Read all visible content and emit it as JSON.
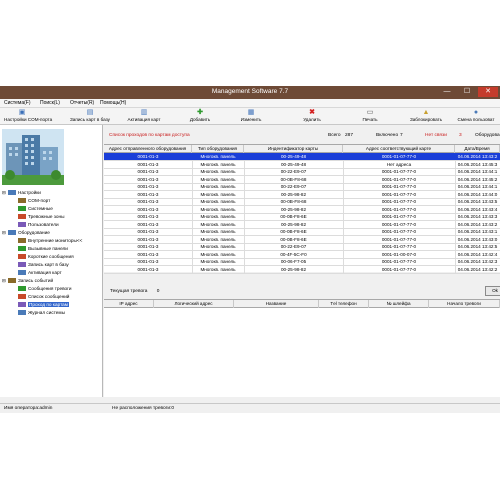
{
  "window": {
    "title": "Management Software 7.7"
  },
  "menu": [
    "Система(F)",
    "Поиск(L)",
    "Отчеты(R)",
    "Помощь(H)"
  ],
  "toolbar": [
    {
      "label": "Настройки COM-порта",
      "icon": "com-port-icon"
    },
    {
      "label": "Запись карт в базу",
      "icon": "card-write-icon"
    },
    {
      "label": "Активация карт",
      "icon": "card-activate-icon"
    },
    {
      "label": "Добавить",
      "icon": "add-icon"
    },
    {
      "label": "Изменить",
      "icon": "edit-icon"
    },
    {
      "label": "Удалить",
      "icon": "delete-icon"
    },
    {
      "label": "Печать",
      "icon": "print-icon"
    },
    {
      "label": "Заблокировать",
      "icon": "lock-icon"
    },
    {
      "label": "Смена пользоват",
      "icon": "user-switch-icon"
    }
  ],
  "tree": [
    {
      "label": "Настройки",
      "level": 0,
      "expander": "⊟"
    },
    {
      "label": "COM-порт",
      "level": 1
    },
    {
      "label": "Системные",
      "level": 1
    },
    {
      "label": "Тревожные зоны",
      "level": 1
    },
    {
      "label": "Пользователи",
      "level": 1
    },
    {
      "label": "Оборудование",
      "level": 0,
      "expander": "⊟"
    },
    {
      "label": "Внутренние мониторы<<",
      "level": 1
    },
    {
      "label": "Вызывные панели",
      "level": 1
    },
    {
      "label": "Короткие сообщения",
      "level": 1
    },
    {
      "label": "Запись карт в базу",
      "level": 1
    },
    {
      "label": "Активация карт",
      "level": 1
    },
    {
      "label": "Запись событий",
      "level": 0,
      "expander": "⊟"
    },
    {
      "label": "Сообщения тревоги",
      "level": 1
    },
    {
      "label": "Список сообщений",
      "level": 1
    },
    {
      "label": "Проход по картам",
      "level": 1,
      "selected": true
    },
    {
      "label": "Журнал системы",
      "level": 1
    }
  ],
  "list_info": {
    "title": "Список проходов по картам доступа",
    "total_label": "Всего",
    "total_value": "287",
    "on_label": "Включено",
    "on_value": "7",
    "noconn_label": "Нет связи",
    "noconn_value": "3",
    "equip_label": "Оборудова"
  },
  "table": {
    "columns": [
      "Адрес отправленного оборудования",
      "Тип оборудования",
      "Индентификатор карты",
      "Адрес соответствующий карте",
      "Дата/Время"
    ],
    "rows": [
      [
        "0001-01-3",
        "Многокв. панель",
        "00-25-49-48",
        "0001-01-07-77-0",
        "04.06.2014 13:43:2"
      ],
      [
        "0001-01-3",
        "Многокв. панель",
        "00-25-49-48",
        "Нет адреса",
        "04.06.2014 13:45:3"
      ],
      [
        "0001-01-3",
        "Многокв. панель",
        "00-22-E9-07",
        "0001-01-07-77-0",
        "04.06.2014 13:44:1"
      ],
      [
        "0001-01-3",
        "Многокв. панель",
        "00-0B-F8-68",
        "0001-01-07-77-0",
        "04.06.2014 13:45:2"
      ],
      [
        "0001-01-3",
        "Многокв. панель",
        "00-22-E9-07",
        "0001-01-07-77-0",
        "04.06.2014 13:44:1"
      ],
      [
        "0001-01-3",
        "Многокв. панель",
        "00-25-98-82",
        "0001-01-07-77-0",
        "04.06.2014 13:44:0"
      ],
      [
        "0001-01-3",
        "Многокв. панель",
        "00-0B-F8-68",
        "0001-01-07-77-0",
        "04.06.2014 13:43:5"
      ],
      [
        "0001-01-3",
        "Многокв. панель",
        "00-25-98-82",
        "0001-01-07-77-0",
        "04.06.2014 13:43:4"
      ],
      [
        "0001-01-3",
        "Многокв. панель",
        "00-0B-F8-6E",
        "0001-01-07-77-0",
        "04.06.2014 13:43:3"
      ],
      [
        "0001-01-3",
        "Многокв. панель",
        "00-25-98-82",
        "0001-01-07-77-0",
        "04.06.2014 13:43:2"
      ],
      [
        "0001-01-3",
        "Многокв. панель",
        "00-0B-F8-6E",
        "0001-01-07-77-0",
        "04.06.2014 13:43:1"
      ],
      [
        "0001-01-3",
        "Многокв. панель",
        "00-0B-F8-6E",
        "0001-01-07-77-0",
        "04.06.2014 13:43:0"
      ],
      [
        "0001-01-3",
        "Многокв. панель",
        "00-22-E9-07",
        "0001-01-07-77-0",
        "04.06.2014 13:42:5"
      ],
      [
        "0001-01-3",
        "Многокв. панель",
        "00-4F-5C-F0",
        "0001-01-00-07-0",
        "04.06.2014 13:42:4"
      ],
      [
        "0001-01-3",
        "Многокв. панель",
        "00-06-F7-05",
        "0001-01-07-77-0",
        "04.06.2014 13:42:3"
      ],
      [
        "0001-01-3",
        "Многокв. панель",
        "00-25-98-82",
        "0001-01-07-77-0",
        "04.06.2014 13:42:2"
      ]
    ],
    "selected_row": 0
  },
  "alarm": {
    "label": "Текущая тревога",
    "count": "0",
    "ok_label": "Ok"
  },
  "alarm_table": {
    "columns": [
      "IP адрес",
      "Логический адрес",
      "Название",
      "Тel телефон",
      "№ шлейфа",
      "Начало тревоги"
    ]
  },
  "status": {
    "operator": "Имя оператора:admin",
    "alarm_place": "Не расположения тревоги:0"
  }
}
